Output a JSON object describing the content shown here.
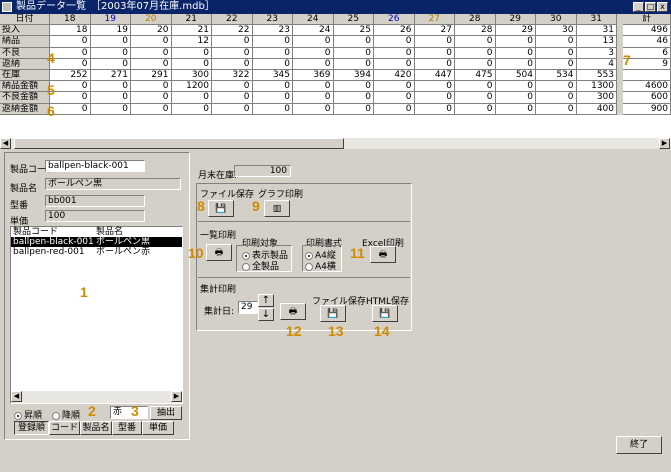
{
  "window": {
    "title": "製品データ一覧　［2003年07月在庫.mdb］",
    "min": "_",
    "max": "□",
    "close": "x"
  },
  "grid": {
    "corner": "日付",
    "days": [
      "18",
      "19",
      "20",
      "21",
      "22",
      "23",
      "24",
      "25",
      "26",
      "27",
      "28",
      "29",
      "30",
      "31"
    ],
    "total_label": "計",
    "rows": [
      {
        "label": "投入",
        "vals": [
          "18",
          "19",
          "20",
          "21",
          "22",
          "23",
          "24",
          "25",
          "26",
          "27",
          "28",
          "29",
          "30",
          "31"
        ],
        "total": "496"
      },
      {
        "label": "納品",
        "vals": [
          "0",
          "0",
          "0",
          "12",
          "0",
          "0",
          "0",
          "0",
          "0",
          "0",
          "0",
          "0",
          "0",
          "13"
        ],
        "total": "46"
      },
      {
        "label": "不良",
        "vals": [
          "0",
          "0",
          "0",
          "0",
          "0",
          "0",
          "0",
          "0",
          "0",
          "0",
          "0",
          "0",
          "0",
          "3"
        ],
        "total": "6"
      },
      {
        "label": "返納",
        "vals": [
          "0",
          "0",
          "0",
          "0",
          "0",
          "0",
          "0",
          "0",
          "0",
          "0",
          "0",
          "0",
          "0",
          "4"
        ],
        "total": "9"
      },
      {
        "label": "在庫",
        "vals": [
          "252",
          "271",
          "291",
          "300",
          "322",
          "345",
          "369",
          "394",
          "420",
          "447",
          "475",
          "504",
          "534",
          "553"
        ],
        "total": ""
      },
      {
        "label": "納品金額",
        "vals": [
          "0",
          "0",
          "0",
          "1200",
          "0",
          "0",
          "0",
          "0",
          "0",
          "0",
          "0",
          "0",
          "0",
          "1300"
        ],
        "total": "4600"
      },
      {
        "label": "不良金額",
        "vals": [
          "0",
          "0",
          "0",
          "0",
          "0",
          "0",
          "0",
          "0",
          "0",
          "0",
          "0",
          "0",
          "0",
          "300"
        ],
        "total": "600"
      },
      {
        "label": "返納金額",
        "vals": [
          "0",
          "0",
          "0",
          "0",
          "0",
          "0",
          "0",
          "0",
          "0",
          "0",
          "0",
          "0",
          "0",
          "400"
        ],
        "total": "900"
      }
    ]
  },
  "form": {
    "code_label": "製品コード",
    "code_value": "ballpen-black-001",
    "name_label": "製品名",
    "name_value": "ボールペン黒",
    "model_label": "型番",
    "model_value": "bb001",
    "price_label": "単価",
    "price_value": "100",
    "month_stock_label": "月末在庫:",
    "month_stock_value": "100"
  },
  "list": {
    "col_code": "製品コード",
    "col_name": "製品名",
    "items": [
      {
        "code": "ballpen-black-001",
        "name": "ボールペン黒"
      },
      {
        "code": "ballpen-red-001",
        "name": "ボールペン赤"
      }
    ]
  },
  "sort": {
    "asc": "昇順",
    "desc": "降順",
    "filter_value": "赤",
    "extract": "抽出",
    "buttons": [
      "登録順",
      "コード",
      "製品名",
      "型番",
      "単価"
    ]
  },
  "panel": {
    "file_save": "ファイル保存",
    "graph_print": "グラフ印刷",
    "list_print": "一覧印刷",
    "print_target": "印刷対象",
    "opt_shown": "表示製品",
    "opt_all": "全製品",
    "print_format": "印刷書式",
    "opt_a4p": "A4縦",
    "opt_a4l": "A4横",
    "excel_print": "Excel印刷",
    "total_print": "集計印刷",
    "total_day_label": "集計日:",
    "total_day_value": "29",
    "file_save2": "ファイル保存",
    "html_save": "HTML保存"
  },
  "exit": "終了",
  "markers": [
    "1",
    "2",
    "3",
    "4",
    "5",
    "6",
    "7",
    "8",
    "9",
    "10",
    "11",
    "12",
    "13",
    "14"
  ]
}
